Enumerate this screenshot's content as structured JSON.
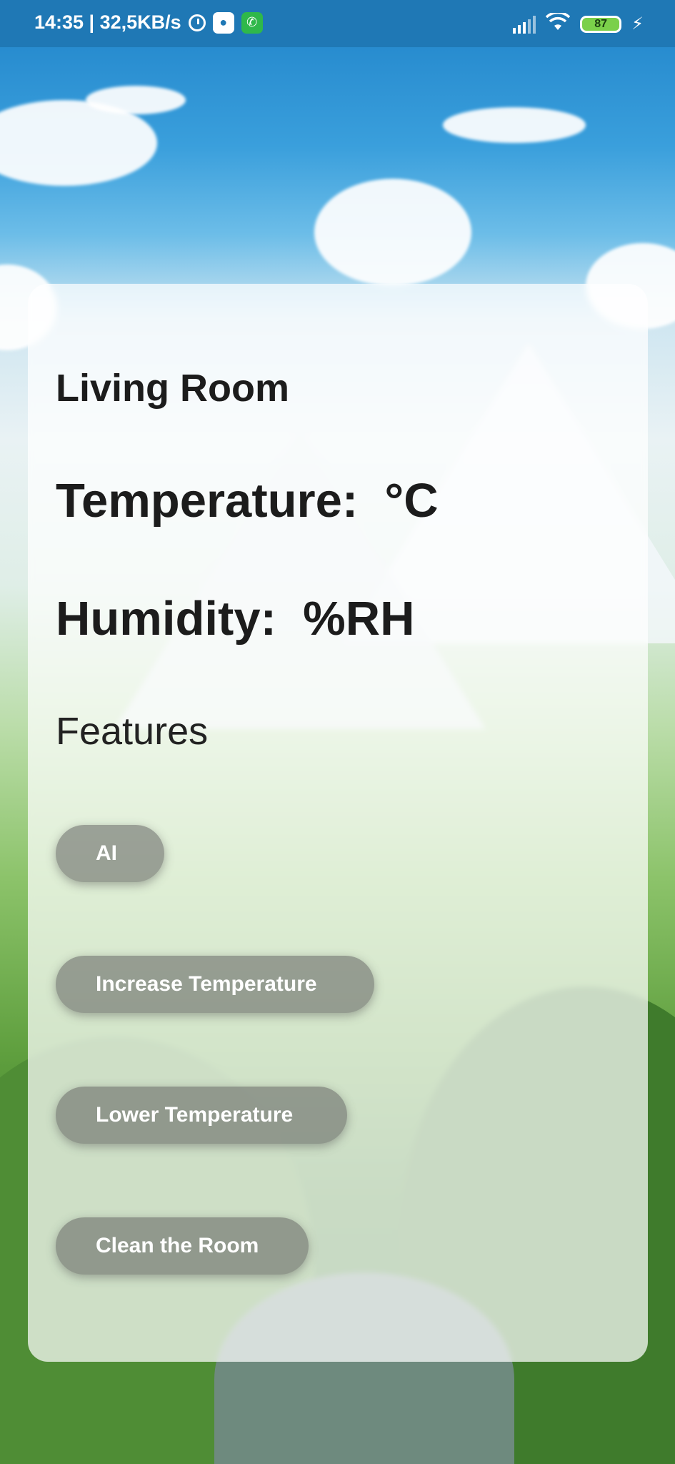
{
  "status_bar": {
    "time_speed": "14:35 | 32,5KB/s",
    "battery": "87",
    "icons": [
      "alarm-icon",
      "message-icon",
      "whatsapp-icon",
      "signal-icon",
      "wifi-icon",
      "battery-icon",
      "charging-icon"
    ]
  },
  "room": {
    "title": "Living Room",
    "temperature_label": "Temperature:  °C",
    "humidity_label": "Humidity:  %RH"
  },
  "features": {
    "title": "Features",
    "buttons": [
      {
        "label": "AI"
      },
      {
        "label": "Increase Temperature"
      },
      {
        "label": "Lower Temperature"
      },
      {
        "label": "Clean the Room"
      }
    ]
  },
  "colors": {
    "status_bar": "#1f78b5",
    "card_overlay": "rgba(255,255,255,0.72)",
    "button_bg": "#5f5f5f"
  }
}
